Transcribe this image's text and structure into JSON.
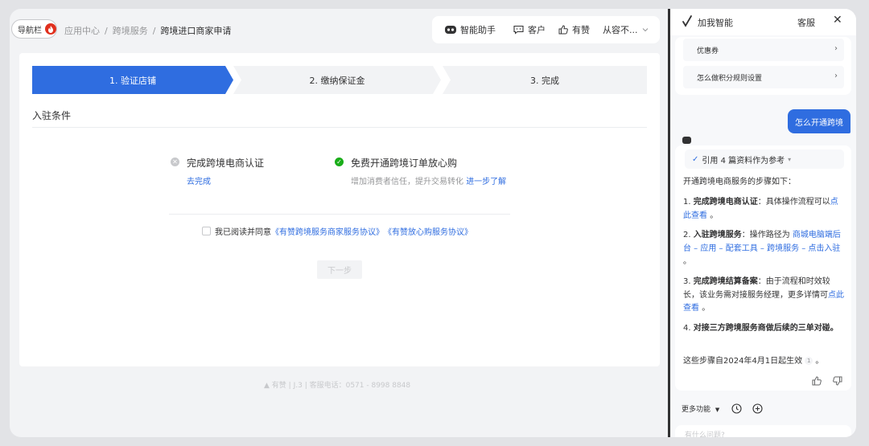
{
  "header": {
    "nav_label": "导航栏",
    "breadcrumb": [
      "应用中心",
      "跨境服务",
      "跨境进口商家申请"
    ],
    "tools": [
      {
        "icon": "robot-icon",
        "label": "智能助手"
      },
      {
        "icon": "chat-icon",
        "label": "客户"
      },
      {
        "icon": "thumb-up-icon",
        "label": "有赞"
      },
      {
        "icon": "chevron-down-icon",
        "label": "从容不..."
      }
    ]
  },
  "steps": [
    {
      "label": "1. 验证店铺",
      "active": true
    },
    {
      "label": "2. 缴纳保证金",
      "active": false
    },
    {
      "label": "3. 完成",
      "active": false
    }
  ],
  "section": {
    "title": "入驻条件"
  },
  "conditions": [
    {
      "status_icon": "x-circle-icon",
      "title": "完成跨境电商认证",
      "action": "去完成"
    },
    {
      "status_icon": "check-circle-icon",
      "title": "免费开通跨境订单放心购",
      "desc": "增加消费者信任，提升交易转化",
      "link": "进一步了解"
    }
  ],
  "agreement": {
    "prefix": "我已阅读并同意",
    "doc1": "《有赞跨境服务商家服务协议》",
    "doc2": "《有赞放心购服务协议》"
  },
  "next_button": "下一步",
  "footer": {
    "brand": "有赞",
    "version": "J.3",
    "hotline": "客服电话：0571 - 8998 8848"
  },
  "panel": {
    "title": "加我智能",
    "service": "客服",
    "quick_questions": [
      "优惠券",
      "怎么做积分规则设置"
    ],
    "user_message": "怎么开通跨境",
    "refs_label": "引用 4 篇资料作为参考",
    "intro": "开通跨境电商服务的步骤如下：",
    "items": [
      {
        "num": "1.",
        "bold": "完成跨境电商认证",
        "text": "：具体操作流程可以",
        "link": "点此查看",
        "end": "。"
      },
      {
        "num": "2.",
        "bold": "入驻跨境服务",
        "text": "：操作路径为",
        "link": "商城电脑端后台 – 应用 – 配套工具 – 跨境服务 – 点击入驻",
        "end": "。"
      },
      {
        "num": "3.",
        "bold": "完成跨境结算备案",
        "text": "：由于流程和时效较长，该业务需对接服务经理，更多详情可",
        "link": "点此查看",
        "end": "。"
      },
      {
        "num": "4.",
        "bold": "对接三方跨境服务商做后续的三单对碰。",
        "text": "",
        "link": "",
        "end": ""
      }
    ],
    "closing": "这些步骤自2024年4月1日起生效",
    "closing_ref": "1",
    "closing_end": "。",
    "more_label": "更多功能",
    "input_placeholder": "有什么问题?"
  },
  "colors": {
    "accent": "#2f6de0",
    "success": "#1aad19",
    "muted": "#c8c9cc"
  }
}
